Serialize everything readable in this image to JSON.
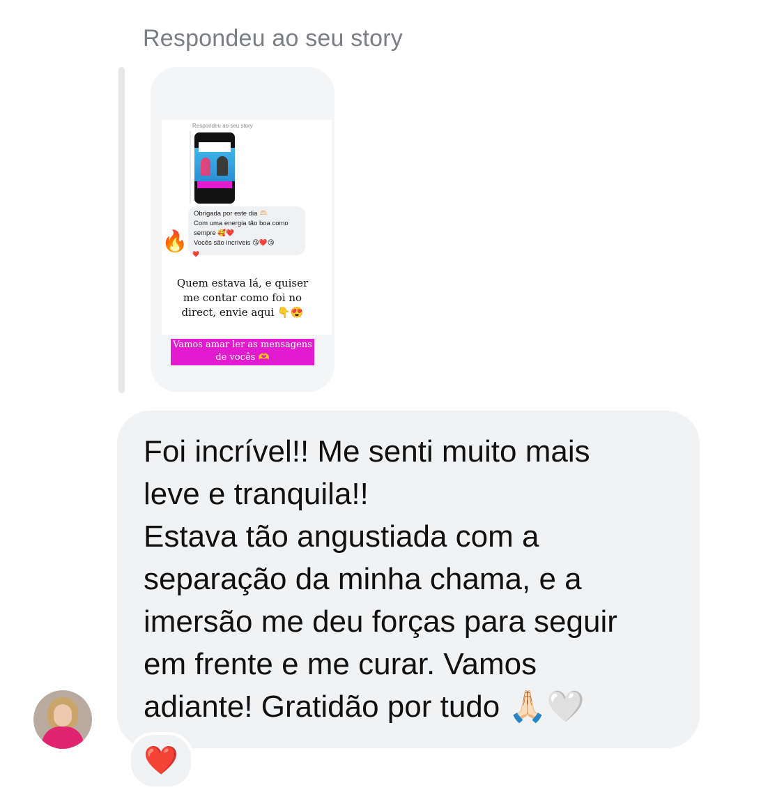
{
  "reply_caption": "Respondeu ao seu story",
  "story": {
    "inner_caption": "Respondeu ao seu story",
    "inner_message_lines": [
      "Obrigada por este dia 🫶🏻",
      "Com uma energia tão boa como",
      "sempre 🥰❤️",
      "Vocês são incríveis 😘❤️😘"
    ],
    "fire_emoji": "🔥",
    "small_heart": "❤️",
    "text_lines": [
      "Quem estava lá, e quiser",
      "me contar como foi no",
      "direct, envie aqui 👇😍"
    ],
    "pink_lines": [
      "Vamos amar ler as mensagens",
      "de vocês 🫶"
    ],
    "colors": {
      "pink": "#e21bd0"
    }
  },
  "message": {
    "lines": [
      "Foi incrível!! Me senti muito mais",
      "leve e tranquila!!",
      "Estava tão angustiada com a",
      "separação da minha chama, e a",
      "imersão me deu forças para seguir",
      "em frente e me curar. Vamos",
      "adiante! Gratidão por tudo 🙏🏻🤍"
    ]
  },
  "reaction": "❤️",
  "colors": {
    "bubble": "#f1f2f4",
    "caption": "#7a7d82",
    "heart": "#e0242e"
  }
}
